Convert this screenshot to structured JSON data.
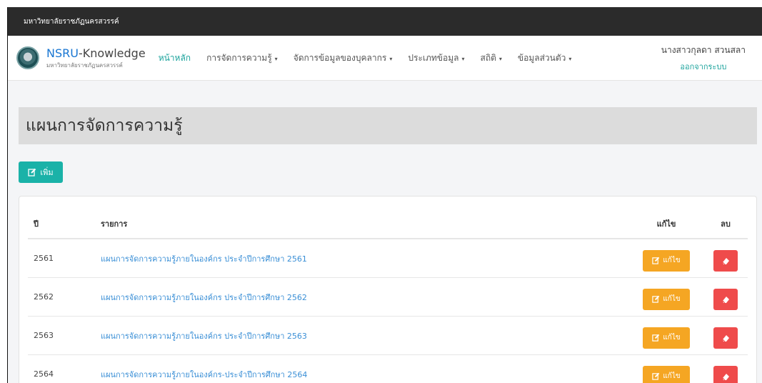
{
  "topbar": {
    "text": "มหาวิทยาลัยราชภัฏนครสวรรค์"
  },
  "brand": {
    "nsru": "NSRU",
    "rest": "-Knowledge",
    "subtitle": "มหาวิทยาลัยราชภัฏนครสวรรค์"
  },
  "nav": {
    "items": [
      {
        "label": "หน้าหลัก",
        "has_caret": false
      },
      {
        "label": "การจัดการความรู้",
        "has_caret": true
      },
      {
        "label": "จัดการข้อมูลของบุคลากร",
        "has_caret": true
      },
      {
        "label": "ประเภทข้อมูล",
        "has_caret": true
      },
      {
        "label": "สถิติ",
        "has_caret": true
      },
      {
        "label": "ข้อมูลส่วนตัว",
        "has_caret": true
      }
    ],
    "caret_glyph": "▾"
  },
  "user": {
    "name": "นางสาวกุลดา สวนสลา",
    "logout": "ออกจากระบบ"
  },
  "page": {
    "title": "แผนการจัดการความรู้"
  },
  "actions": {
    "add_label": "เพิ่ม"
  },
  "table": {
    "headers": {
      "year": "ปี",
      "item": "รายการ",
      "edit": "แก้ไข",
      "delete": "ลบ"
    },
    "edit_button_label": "แก้ไข",
    "rows": [
      {
        "year": "2561",
        "title": "แผนการจัดการความรู้ภายในองค์กร ประจำปีการศึกษา 2561"
      },
      {
        "year": "2562",
        "title": "แผนการจัดการความรู้ภายในองค์กร ประจำปีการศึกษา 2562"
      },
      {
        "year": "2563",
        "title": "แผนการจัดการความรู้ภายในองค์กร ประจำปีการศึกษา 2563"
      },
      {
        "year": "2564",
        "title": "แผนการจัดการความรู้ภายในองค์กร-ประจำปีการศึกษา 2564"
      }
    ]
  },
  "colors": {
    "accent": "#1ab2a8",
    "edit": "#f5a623",
    "delete": "#ef4b4b",
    "link": "#3a8fd6"
  },
  "icons": {
    "add": "edit-icon",
    "edit": "edit-icon",
    "delete": "eraser-icon",
    "logo": "university-seal-icon"
  }
}
